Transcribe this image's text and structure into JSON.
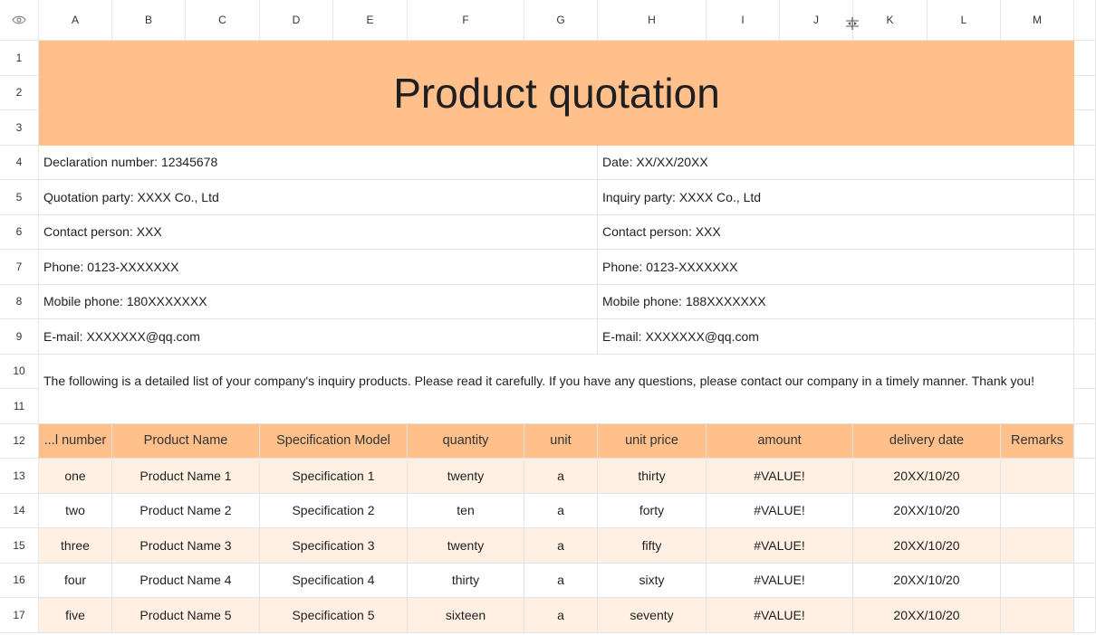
{
  "columns": [
    "A",
    "B",
    "C",
    "D",
    "E",
    "F",
    "G",
    "H",
    "I",
    "J",
    "K",
    "L",
    "M"
  ],
  "rows": [
    "1",
    "2",
    "3",
    "4",
    "5",
    "6",
    "7",
    "8",
    "9",
    "10",
    "11",
    "12",
    "13",
    "14",
    "15",
    "16",
    "17"
  ],
  "title": "Product quotation",
  "info_left": [
    "Declaration number: 12345678",
    "Quotation party: XXXX Co., Ltd",
    "Contact person: XXX",
    "Phone: 0123-XXXXXXX",
    "Mobile phone: 180XXXXXXX",
    "E-mail:  XXXXXXX@qq.com"
  ],
  "info_right": [
    "Date: XX/XX/20XX",
    "Inquiry party: XXXX Co., Ltd",
    "Contact person: XXX",
    "Phone: 0123-XXXXXXX",
    "Mobile phone: 188XXXXXXX",
    "E-mail:  XXXXXXX@qq.com"
  ],
  "note": "The following is a detailed list of your company's inquiry products. Please read it carefully. If you have any questions, please contact our company in a timely manner. Thank you!",
  "table": {
    "headers": [
      "...l number",
      "Product Name",
      "Specification Model",
      "quantity",
      "unit",
      "unit price",
      "amount",
      "delivery date",
      "Remarks"
    ],
    "rows": [
      [
        "one",
        "Product Name 1",
        "Specification 1",
        "twenty",
        "a",
        "thirty",
        "#VALUE!",
        "20XX/10/20",
        ""
      ],
      [
        "two",
        "Product Name 2",
        "Specification 2",
        "ten",
        "a",
        "forty",
        "#VALUE!",
        "20XX/10/20",
        ""
      ],
      [
        "three",
        "Product Name 3",
        "Specification 3",
        "twenty",
        "a",
        "fifty",
        "#VALUE!",
        "20XX/10/20",
        ""
      ],
      [
        "four",
        "Product Name 4",
        "Specification 4",
        "thirty",
        "a",
        "sixty",
        "#VALUE!",
        "20XX/10/20",
        ""
      ],
      [
        "five",
        "Product Name 5",
        "Specification 5",
        "sixteen",
        "a",
        "seventy",
        "#VALUE!",
        "20XX/10/20",
        ""
      ]
    ]
  },
  "colors": {
    "header_fill": "#ffc08b",
    "band_fill": "#fff0e3"
  },
  "icons": {
    "corner": "eye-icon",
    "column_resize": "column-resize-icon"
  }
}
